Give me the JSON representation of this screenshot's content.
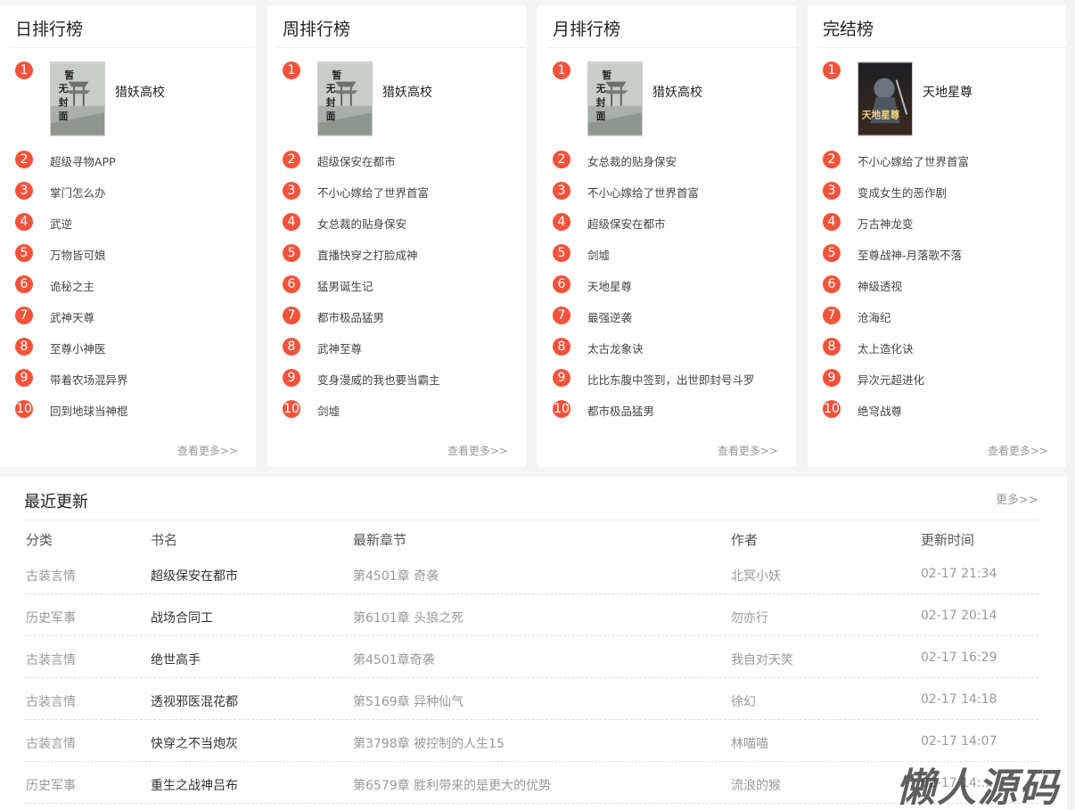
{
  "rankings": [
    {
      "title": "日排行榜",
      "top": {
        "name": "猎妖高校",
        "cover": "placeholder"
      },
      "items": [
        "超级寻物APP",
        "掌门怎么办",
        "武逆",
        "万物皆可娘",
        "诡秘之主",
        "武神天尊",
        "至尊小神医",
        "带着农场混异界",
        "回到地球当神棍"
      ],
      "more": "查看更多>>"
    },
    {
      "title": "周排行榜",
      "top": {
        "name": "猎妖高校",
        "cover": "placeholder"
      },
      "items": [
        "超级保安在都市",
        "不小心嫁给了世界首富",
        "女总裁的贴身保安",
        "直播快穿之打脸成神",
        "猛男诞生记",
        "都市极品猛男",
        "武神至尊",
        "变身漫威的我也要当霸主",
        "剑墟"
      ],
      "more": "查看更多>>"
    },
    {
      "title": "月排行榜",
      "top": {
        "name": "猎妖高校",
        "cover": "placeholder"
      },
      "items": [
        "女总裁的贴身保安",
        "不小心嫁给了世界首富",
        "超级保安在都市",
        "剑墟",
        "天地星尊",
        "最强逆袭",
        "太古龙象诀",
        "比比东腹中签到，出世即封号斗罗",
        "都市极品猛男"
      ],
      "more": "查看更多>>"
    },
    {
      "title": "完结榜",
      "top": {
        "name": "天地星尊",
        "cover": "art"
      },
      "items": [
        "不小心嫁给了世界首富",
        "变成女生的恶作剧",
        "万古神龙变",
        "至尊战神-月落歌不落",
        "神级透视",
        "沧海纪",
        "太上造化诀",
        "异次元超进化",
        "绝穹战尊"
      ],
      "more": "查看更多>>"
    }
  ],
  "placeholder_cover_text": [
    "暂",
    "无",
    "封",
    "面"
  ],
  "art_cover_text": "天地星尊",
  "recent": {
    "title": "最近更新",
    "more": "更多>>",
    "headers": [
      "分类",
      "书名",
      "最新章节",
      "作者",
      "更新时间"
    ],
    "rows": [
      [
        "古装言情",
        "超级保安在都市",
        "第4501章 奇袭",
        "北冥小妖",
        "02-17 21:34"
      ],
      [
        "历史军事",
        "战场合同工",
        "第6101章 头狼之死",
        "勿亦行",
        "02-17 20:14"
      ],
      [
        "古装言情",
        "绝世高手",
        "第4501章奇袭",
        "我自对天笑",
        "02-17 16:29"
      ],
      [
        "古装言情",
        "透视邪医混花都",
        "第5169章 异种仙气",
        "徐幻",
        "02-17 14:18"
      ],
      [
        "古装言情",
        "快穿之不当炮灰",
        "第3798章 被控制的人生15",
        "林喵喵",
        "02-17 14:07"
      ],
      [
        "历史军事",
        "重生之战神吕布",
        "第6579章 胜利带来的是更大的优势",
        "流浪的猴",
        "02-17 14:..."
      ]
    ]
  },
  "watermark": "懒人源码",
  "colors": {
    "accent": "#f3533b"
  }
}
